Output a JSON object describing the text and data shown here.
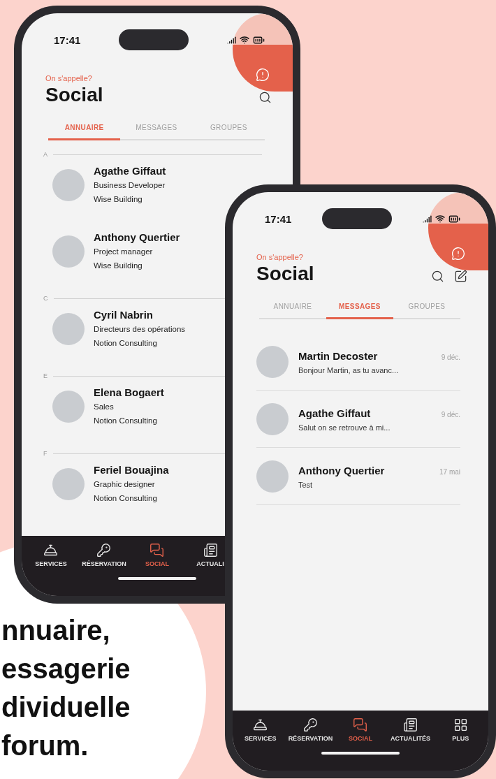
{
  "phones": [
    {
      "kind": "directory",
      "status_time": "17:41",
      "kicker": "On s'appelle?",
      "title": "Social",
      "tabs": [
        {
          "label": "ANNUAIRE",
          "selected": true
        },
        {
          "label": "MESSAGES",
          "selected": false
        },
        {
          "label": "GROUPES",
          "selected": false
        }
      ],
      "sections": [
        {
          "letter": "A",
          "contacts": [
            {
              "name": "Agathe Giffaut",
              "role": "Business Developer",
              "company": "Wise Building"
            },
            {
              "name": "Anthony Quertier",
              "role": "Project manager",
              "company": "Wise Building"
            }
          ]
        },
        {
          "letter": "C",
          "contacts": [
            {
              "name": "Cyril Nabrin",
              "role": "Directeurs des opérations",
              "company": "Notion Consulting"
            }
          ]
        },
        {
          "letter": "E",
          "contacts": [
            {
              "name": "Elena Bogaert",
              "role": "Sales",
              "company": "Notion Consulting"
            }
          ]
        },
        {
          "letter": "F",
          "contacts": [
            {
              "name": "Feriel Bouajina",
              "role": "Graphic designer",
              "company": "Notion Consulting"
            }
          ]
        }
      ],
      "nav": [
        {
          "label": "SERVICES",
          "selected": false
        },
        {
          "label": "RÉSERVATION",
          "selected": false
        },
        {
          "label": "SOCIAL",
          "selected": true
        },
        {
          "label": "ACTUALI",
          "selected": false
        }
      ]
    },
    {
      "kind": "messages",
      "status_time": "17:41",
      "kicker": "On s'appelle?",
      "title": "Social",
      "tabs": [
        {
          "label": "ANNUAIRE",
          "selected": false
        },
        {
          "label": "MESSAGES",
          "selected": true
        },
        {
          "label": "GROUPES",
          "selected": false
        }
      ],
      "conversations": [
        {
          "name": "Martin Decoster",
          "preview": "Bonjour Martin, as tu avanc...",
          "date": "9 déc."
        },
        {
          "name": "Agathe Giffaut",
          "preview": "Salut on se retrouve à mi...",
          "date": "9 déc."
        },
        {
          "name": "Anthony Quertier",
          "preview": "Test",
          "date": "17 mai"
        }
      ],
      "nav": [
        {
          "label": "SERVICES",
          "selected": false
        },
        {
          "label": "RÉSERVATION",
          "selected": false
        },
        {
          "label": "SOCIAL",
          "selected": true
        },
        {
          "label": "ACTUALITÉS",
          "selected": false
        },
        {
          "label": "PLUS",
          "selected": false
        }
      ]
    }
  ],
  "caption": {
    "lines": [
      "nnuaire,",
      "essagerie",
      "dividuelle",
      "forum."
    ]
  }
}
